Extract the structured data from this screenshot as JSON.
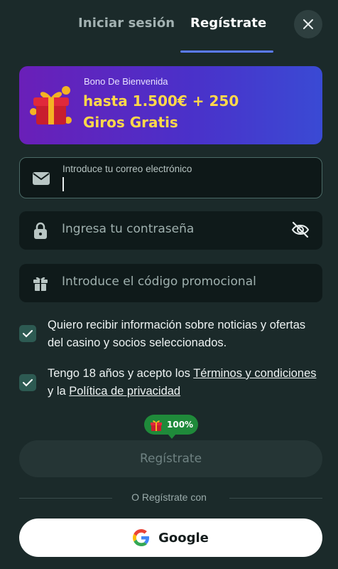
{
  "tabs": {
    "login_label": "Iniciar sesión",
    "register_label": "Regístrate",
    "active": "register"
  },
  "bonus": {
    "subtitle": "Bono De Bienvenida",
    "line1": "hasta 1.500€ + 250",
    "line2": "Giros Gratis",
    "icon": "gift-icon"
  },
  "form": {
    "email": {
      "label": "Introduce tu correo electrónico",
      "value": "",
      "icon": "mail-icon"
    },
    "password": {
      "placeholder": "Ingresa tu contraseña",
      "icon": "lock-icon",
      "toggle_icon": "eye-off-icon"
    },
    "promo": {
      "placeholder": "Introduce el código promocional",
      "icon": "gift-icon"
    }
  },
  "consents": {
    "marketing": {
      "checked": true,
      "text": "Quiero recibir información sobre noticias y ofertas del casino y socios seleccionados."
    },
    "terms": {
      "checked": true,
      "prefix": "Tengo 18 años y acepto los ",
      "terms_link": "Términos y condiciones",
      "middle": " y la ",
      "privacy_link": "Política de privacidad"
    }
  },
  "badge": {
    "text": "100%",
    "icon": "gift-icon"
  },
  "register_button": {
    "label": "Regístrate"
  },
  "divider_text": "O Regístrate con",
  "google_button": {
    "label": "Google",
    "icon": "google-icon"
  },
  "colors": {
    "background": "#1b2a2a",
    "accent": "#5b7bff",
    "bonus_text": "#ffd84a",
    "checkbox": "#2d5a52",
    "badge": "#1f8a3a"
  }
}
